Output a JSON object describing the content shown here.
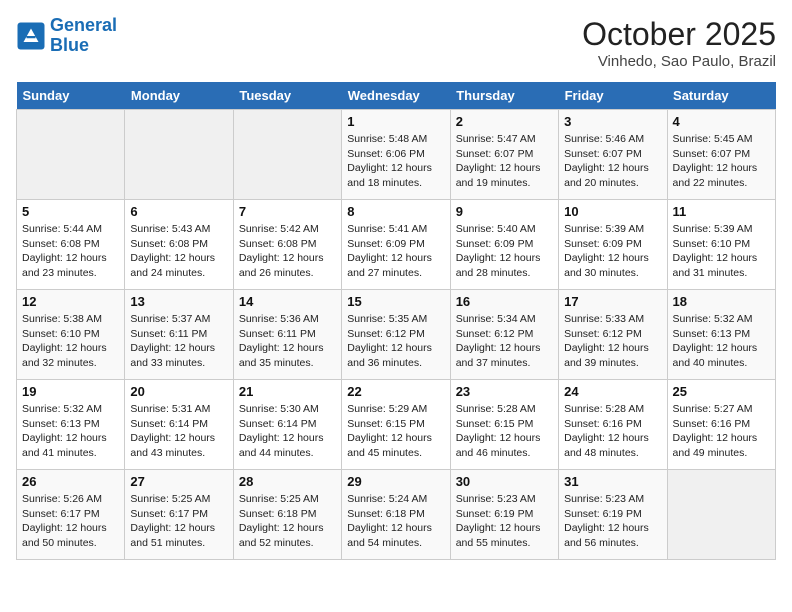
{
  "header": {
    "logo_line1": "General",
    "logo_line2": "Blue",
    "month_title": "October 2025",
    "location": "Vinhedo, Sao Paulo, Brazil"
  },
  "days_of_week": [
    "Sunday",
    "Monday",
    "Tuesday",
    "Wednesday",
    "Thursday",
    "Friday",
    "Saturday"
  ],
  "weeks": [
    [
      {
        "day": "",
        "info": ""
      },
      {
        "day": "",
        "info": ""
      },
      {
        "day": "",
        "info": ""
      },
      {
        "day": "1",
        "info": "Sunrise: 5:48 AM\nSunset: 6:06 PM\nDaylight: 12 hours and 18 minutes."
      },
      {
        "day": "2",
        "info": "Sunrise: 5:47 AM\nSunset: 6:07 PM\nDaylight: 12 hours and 19 minutes."
      },
      {
        "day": "3",
        "info": "Sunrise: 5:46 AM\nSunset: 6:07 PM\nDaylight: 12 hours and 20 minutes."
      },
      {
        "day": "4",
        "info": "Sunrise: 5:45 AM\nSunset: 6:07 PM\nDaylight: 12 hours and 22 minutes."
      }
    ],
    [
      {
        "day": "5",
        "info": "Sunrise: 5:44 AM\nSunset: 6:08 PM\nDaylight: 12 hours and 23 minutes."
      },
      {
        "day": "6",
        "info": "Sunrise: 5:43 AM\nSunset: 6:08 PM\nDaylight: 12 hours and 24 minutes."
      },
      {
        "day": "7",
        "info": "Sunrise: 5:42 AM\nSunset: 6:08 PM\nDaylight: 12 hours and 26 minutes."
      },
      {
        "day": "8",
        "info": "Sunrise: 5:41 AM\nSunset: 6:09 PM\nDaylight: 12 hours and 27 minutes."
      },
      {
        "day": "9",
        "info": "Sunrise: 5:40 AM\nSunset: 6:09 PM\nDaylight: 12 hours and 28 minutes."
      },
      {
        "day": "10",
        "info": "Sunrise: 5:39 AM\nSunset: 6:09 PM\nDaylight: 12 hours and 30 minutes."
      },
      {
        "day": "11",
        "info": "Sunrise: 5:39 AM\nSunset: 6:10 PM\nDaylight: 12 hours and 31 minutes."
      }
    ],
    [
      {
        "day": "12",
        "info": "Sunrise: 5:38 AM\nSunset: 6:10 PM\nDaylight: 12 hours and 32 minutes."
      },
      {
        "day": "13",
        "info": "Sunrise: 5:37 AM\nSunset: 6:11 PM\nDaylight: 12 hours and 33 minutes."
      },
      {
        "day": "14",
        "info": "Sunrise: 5:36 AM\nSunset: 6:11 PM\nDaylight: 12 hours and 35 minutes."
      },
      {
        "day": "15",
        "info": "Sunrise: 5:35 AM\nSunset: 6:12 PM\nDaylight: 12 hours and 36 minutes."
      },
      {
        "day": "16",
        "info": "Sunrise: 5:34 AM\nSunset: 6:12 PM\nDaylight: 12 hours and 37 minutes."
      },
      {
        "day": "17",
        "info": "Sunrise: 5:33 AM\nSunset: 6:12 PM\nDaylight: 12 hours and 39 minutes."
      },
      {
        "day": "18",
        "info": "Sunrise: 5:32 AM\nSunset: 6:13 PM\nDaylight: 12 hours and 40 minutes."
      }
    ],
    [
      {
        "day": "19",
        "info": "Sunrise: 5:32 AM\nSunset: 6:13 PM\nDaylight: 12 hours and 41 minutes."
      },
      {
        "day": "20",
        "info": "Sunrise: 5:31 AM\nSunset: 6:14 PM\nDaylight: 12 hours and 43 minutes."
      },
      {
        "day": "21",
        "info": "Sunrise: 5:30 AM\nSunset: 6:14 PM\nDaylight: 12 hours and 44 minutes."
      },
      {
        "day": "22",
        "info": "Sunrise: 5:29 AM\nSunset: 6:15 PM\nDaylight: 12 hours and 45 minutes."
      },
      {
        "day": "23",
        "info": "Sunrise: 5:28 AM\nSunset: 6:15 PM\nDaylight: 12 hours and 46 minutes."
      },
      {
        "day": "24",
        "info": "Sunrise: 5:28 AM\nSunset: 6:16 PM\nDaylight: 12 hours and 48 minutes."
      },
      {
        "day": "25",
        "info": "Sunrise: 5:27 AM\nSunset: 6:16 PM\nDaylight: 12 hours and 49 minutes."
      }
    ],
    [
      {
        "day": "26",
        "info": "Sunrise: 5:26 AM\nSunset: 6:17 PM\nDaylight: 12 hours and 50 minutes."
      },
      {
        "day": "27",
        "info": "Sunrise: 5:25 AM\nSunset: 6:17 PM\nDaylight: 12 hours and 51 minutes."
      },
      {
        "day": "28",
        "info": "Sunrise: 5:25 AM\nSunset: 6:18 PM\nDaylight: 12 hours and 52 minutes."
      },
      {
        "day": "29",
        "info": "Sunrise: 5:24 AM\nSunset: 6:18 PM\nDaylight: 12 hours and 54 minutes."
      },
      {
        "day": "30",
        "info": "Sunrise: 5:23 AM\nSunset: 6:19 PM\nDaylight: 12 hours and 55 minutes."
      },
      {
        "day": "31",
        "info": "Sunrise: 5:23 AM\nSunset: 6:19 PM\nDaylight: 12 hours and 56 minutes."
      },
      {
        "day": "",
        "info": ""
      }
    ]
  ]
}
